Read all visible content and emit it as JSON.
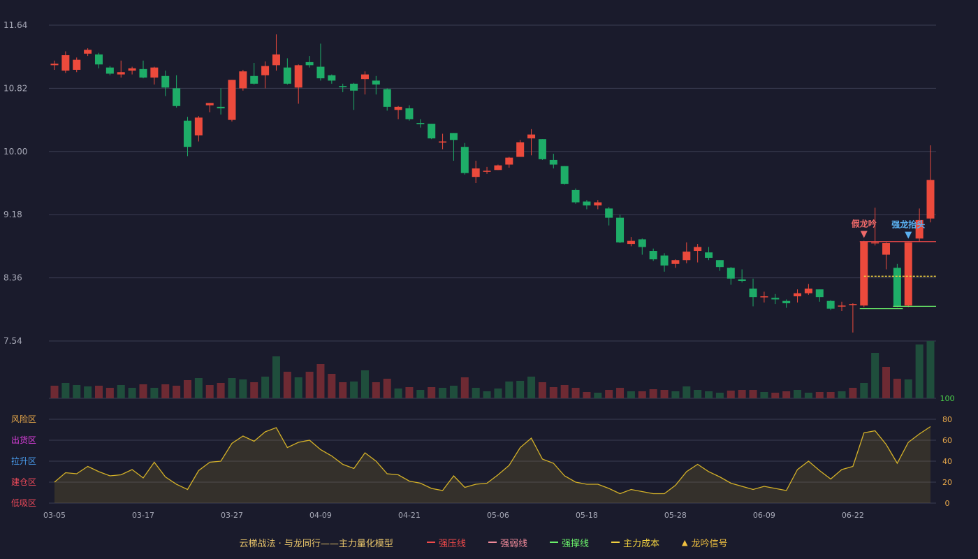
{
  "chart_data": {
    "type": "candlestick",
    "price_axis": {
      "ticks": [
        "11.64",
        "10.82",
        "10.00",
        "9.18",
        "8.36",
        "7.54"
      ],
      "min": 7.54,
      "max": 11.64
    },
    "oscillator_axis": {
      "ticks": [
        "100",
        "80",
        "60",
        "40",
        "20",
        "0"
      ],
      "min": 0,
      "max": 100
    },
    "zones": [
      {
        "label": "风险区",
        "value": 80,
        "color": "#e8a84a"
      },
      {
        "label": "出货区",
        "value": 60,
        "color": "#e040e0"
      },
      {
        "label": "拉升区",
        "value": 40,
        "color": "#4a9ef0"
      },
      {
        "label": "建仓区",
        "value": 20,
        "color": "#f04a5a"
      },
      {
        "label": "低吸区",
        "value": 0,
        "color": "#f04a5a"
      }
    ],
    "x_labels": [
      {
        "i": 0,
        "label": "03-05"
      },
      {
        "i": 8,
        "label": "03-17"
      },
      {
        "i": 16,
        "label": "03-27"
      },
      {
        "i": 24,
        "label": "04-09"
      },
      {
        "i": 32,
        "label": "04-21"
      },
      {
        "i": 40,
        "label": "05-06"
      },
      {
        "i": 48,
        "label": "05-18"
      },
      {
        "i": 56,
        "label": "05-28"
      },
      {
        "i": 64,
        "label": "06-09"
      },
      {
        "i": 72,
        "label": "06-22"
      }
    ],
    "candles": [
      [
        11.12,
        11.14,
        11.06,
        11.18
      ],
      [
        11.05,
        11.25,
        11.02,
        11.3
      ],
      [
        11.06,
        11.19,
        11.03,
        11.22
      ],
      [
        11.27,
        11.32,
        11.24,
        11.34
      ],
      [
        11.26,
        11.13,
        11.08,
        11.28
      ],
      [
        11.09,
        11.01,
        10.99,
        11.11
      ],
      [
        11.0,
        11.03,
        10.96,
        11.18
      ],
      [
        11.05,
        11.08,
        11.0,
        11.1
      ],
      [
        11.07,
        10.96,
        10.95,
        11.18
      ],
      [
        10.96,
        11.09,
        10.87,
        11.1
      ],
      [
        10.98,
        10.83,
        10.72,
        11.05
      ],
      [
        10.82,
        10.59,
        10.57,
        10.99
      ],
      [
        10.4,
        10.06,
        9.94,
        10.45
      ],
      [
        10.21,
        10.44,
        10.13,
        10.46
      ],
      [
        10.6,
        10.63,
        10.51,
        10.63
      ],
      [
        10.58,
        10.56,
        10.48,
        10.82
      ],
      [
        10.41,
        10.93,
        10.39,
        10.93
      ],
      [
        10.82,
        11.04,
        10.79,
        11.06
      ],
      [
        10.98,
        10.88,
        10.87,
        11.15
      ],
      [
        10.99,
        11.11,
        10.82,
        11.17
      ],
      [
        11.12,
        11.26,
        11.05,
        11.52
      ],
      [
        11.09,
        10.88,
        10.87,
        11.21
      ],
      [
        10.83,
        11.12,
        10.62,
        11.13
      ],
      [
        11.16,
        11.12,
        11.09,
        11.24
      ],
      [
        11.1,
        10.95,
        10.92,
        11.4
      ],
      [
        10.99,
        10.92,
        10.88,
        11.0
      ],
      [
        10.85,
        10.84,
        10.77,
        10.88
      ],
      [
        10.88,
        10.79,
        10.54,
        10.89
      ],
      [
        10.94,
        11.0,
        10.74,
        11.04
      ],
      [
        10.92,
        10.87,
        10.74,
        10.98
      ],
      [
        10.81,
        10.58,
        10.53,
        10.82
      ],
      [
        10.54,
        10.58,
        10.42,
        10.59
      ],
      [
        10.56,
        10.42,
        10.4,
        10.6
      ],
      [
        10.37,
        10.36,
        10.31,
        10.42
      ],
      [
        10.36,
        10.17,
        10.16,
        10.36
      ],
      [
        10.12,
        10.13,
        10.03,
        10.23
      ],
      [
        10.24,
        10.15,
        9.88,
        10.24
      ],
      [
        10.06,
        9.72,
        9.7,
        10.11
      ],
      [
        9.67,
        9.78,
        9.59,
        9.88
      ],
      [
        9.74,
        9.75,
        9.71,
        9.8
      ],
      [
        9.76,
        9.82,
        9.76,
        9.83
      ],
      [
        9.83,
        9.92,
        9.79,
        9.93
      ],
      [
        9.93,
        10.12,
        9.93,
        10.15
      ],
      [
        10.17,
        10.22,
        9.95,
        10.29
      ],
      [
        10.16,
        9.9,
        9.89,
        10.16
      ],
      [
        9.89,
        9.83,
        9.78,
        9.97
      ],
      [
        9.81,
        9.58,
        9.57,
        9.81
      ],
      [
        9.5,
        9.34,
        9.32,
        9.52
      ],
      [
        9.35,
        9.3,
        9.25,
        9.37
      ],
      [
        9.3,
        9.34,
        9.25,
        9.37
      ],
      [
        9.26,
        9.14,
        9.04,
        9.28
      ],
      [
        9.14,
        8.82,
        8.81,
        9.18
      ],
      [
        8.8,
        8.84,
        8.77,
        8.89
      ],
      [
        8.86,
        8.76,
        8.66,
        8.87
      ],
      [
        8.71,
        8.6,
        8.58,
        8.74
      ],
      [
        8.65,
        8.52,
        8.44,
        8.68
      ],
      [
        8.54,
        8.59,
        8.49,
        8.6
      ],
      [
        8.59,
        8.7,
        8.55,
        8.82
      ],
      [
        8.71,
        8.76,
        8.56,
        8.8
      ],
      [
        8.69,
        8.62,
        8.59,
        8.76
      ],
      [
        8.59,
        8.5,
        8.45,
        8.59
      ],
      [
        8.49,
        8.35,
        8.27,
        8.5
      ],
      [
        8.34,
        8.32,
        8.3,
        8.47
      ],
      [
        8.22,
        8.11,
        7.99,
        8.35
      ],
      [
        8.11,
        8.12,
        8.04,
        8.18
      ],
      [
        8.1,
        8.08,
        8.02,
        8.15
      ],
      [
        8.06,
        8.03,
        7.97,
        8.08
      ],
      [
        8.12,
        8.16,
        8.04,
        8.21
      ],
      [
        8.16,
        8.22,
        8.14,
        8.28
      ],
      [
        8.21,
        8.11,
        8.05,
        8.21
      ],
      [
        8.06,
        7.96,
        7.94,
        8.07
      ],
      [
        8.0,
        8.0,
        7.93,
        8.05
      ],
      [
        8.01,
        8.02,
        7.65,
        8.03
      ],
      [
        8.0,
        8.83,
        7.98,
        8.84
      ],
      [
        8.82,
        8.82,
        8.78,
        9.27
      ],
      [
        8.66,
        8.81,
        8.47,
        8.82
      ],
      [
        8.49,
        7.99,
        7.98,
        8.54
      ],
      [
        8.0,
        8.82,
        7.98,
        8.82
      ],
      [
        8.87,
        9.11,
        8.83,
        9.26
      ],
      [
        9.13,
        9.63,
        9.08,
        10.08
      ]
    ],
    "volume": [
      [
        18,
        "up"
      ],
      [
        22,
        "down"
      ],
      [
        19,
        "down"
      ],
      [
        17,
        "down"
      ],
      [
        18,
        "up"
      ],
      [
        15,
        "up"
      ],
      [
        19,
        "down"
      ],
      [
        15,
        "down"
      ],
      [
        20,
        "up"
      ],
      [
        15,
        "down"
      ],
      [
        20,
        "up"
      ],
      [
        18,
        "up"
      ],
      [
        26,
        "up"
      ],
      [
        29,
        "down"
      ],
      [
        19,
        "up"
      ],
      [
        22,
        "up"
      ],
      [
        29,
        "down"
      ],
      [
        27,
        "down"
      ],
      [
        23,
        "up"
      ],
      [
        31,
        "down"
      ],
      [
        60,
        "down"
      ],
      [
        38,
        "up"
      ],
      [
        30,
        "down"
      ],
      [
        38,
        "up"
      ],
      [
        49,
        "up"
      ],
      [
        35,
        "up"
      ],
      [
        23,
        "up"
      ],
      [
        24,
        "down"
      ],
      [
        40,
        "down"
      ],
      [
        23,
        "up"
      ],
      [
        28,
        "up"
      ],
      [
        14,
        "down"
      ],
      [
        16,
        "up"
      ],
      [
        12,
        "down"
      ],
      [
        16,
        "up"
      ],
      [
        15,
        "down"
      ],
      [
        18,
        "down"
      ],
      [
        30,
        "up"
      ],
      [
        15,
        "down"
      ],
      [
        10,
        "down"
      ],
      [
        14,
        "down"
      ],
      [
        24,
        "down"
      ],
      [
        25,
        "down"
      ],
      [
        31,
        "down"
      ],
      [
        23,
        "up"
      ],
      [
        16,
        "up"
      ],
      [
        19,
        "up"
      ],
      [
        15,
        "up"
      ],
      [
        9,
        "up"
      ],
      [
        8,
        "down"
      ],
      [
        12,
        "up"
      ],
      [
        15,
        "up"
      ],
      [
        10,
        "down"
      ],
      [
        10,
        "up"
      ],
      [
        13,
        "up"
      ],
      [
        12,
        "up"
      ],
      [
        10,
        "down"
      ],
      [
        17,
        "down"
      ],
      [
        12,
        "down"
      ],
      [
        10,
        "down"
      ],
      [
        8,
        "down"
      ],
      [
        11,
        "up"
      ],
      [
        12,
        "up"
      ],
      [
        12,
        "up"
      ],
      [
        9,
        "down"
      ],
      [
        8,
        "up"
      ],
      [
        10,
        "up"
      ],
      [
        12,
        "down"
      ],
      [
        8,
        "down"
      ],
      [
        9,
        "up"
      ],
      [
        9,
        "up"
      ],
      [
        10,
        "down"
      ],
      [
        15,
        "up"
      ],
      [
        22,
        "down"
      ],
      [
        65,
        "down"
      ],
      [
        45,
        "up"
      ],
      [
        28,
        "up"
      ],
      [
        27,
        "down"
      ],
      [
        77,
        "down"
      ],
      [
        82,
        "down"
      ]
    ],
    "volume_max": 82,
    "oscillator": [
      20,
      29,
      28,
      35,
      30,
      26,
      27,
      32,
      24,
      39,
      25,
      18,
      13,
      31,
      39,
      40,
      57,
      64,
      59,
      68,
      72,
      53,
      58,
      60,
      51,
      45,
      37,
      33,
      48,
      40,
      28,
      27,
      21,
      19,
      14,
      12,
      26,
      15,
      18,
      19,
      27,
      36,
      53,
      62,
      42,
      38,
      26,
      20,
      18,
      18,
      14,
      9,
      13,
      11,
      9,
      9,
      17,
      30,
      37,
      30,
      25,
      19,
      16,
      13,
      16,
      14,
      12,
      32,
      40,
      31,
      23,
      32,
      35,
      67,
      69,
      56,
      38,
      58,
      66,
      73
    ],
    "strong_pressure_line": {
      "value": 8.83,
      "from": 73,
      "to": 79,
      "label": "强压线",
      "color": "#f04a4a"
    },
    "strong_support_line": [
      {
        "value": 7.96,
        "from": 73,
        "to": 76
      },
      {
        "value": 7.99,
        "from": 76,
        "to": 79
      }
    ],
    "main_cost_line": {
      "value": 8.38,
      "from": 73,
      "to": 79
    },
    "signals": [
      {
        "i": 73,
        "label": "假龙吟",
        "color": "#f06a6a",
        "price": 8.86
      },
      {
        "i": 77,
        "label": "强龙抬头",
        "color": "#5ab0f0",
        "price": 8.85
      }
    ],
    "colors": {
      "up": "#ec4a3c",
      "down": "#1ead68",
      "vol_up": "#6e2a33",
      "vol_down": "#1f4e3c",
      "osc": "#d4b128"
    }
  },
  "legend": {
    "title": "云梯战法 · 与龙同行——主力量化模型",
    "items": [
      {
        "label": "强压线",
        "color": "#f04a4a",
        "style": "solid"
      },
      {
        "label": "强弱线",
        "color": "#f08a9a",
        "style": "dashed"
      },
      {
        "label": "强撑线",
        "color": "#6af06a",
        "style": "solid"
      },
      {
        "label": "主力成本",
        "color": "#f0d040",
        "style": "dashed"
      },
      {
        "label": "龙吟信号",
        "color": "#f0c040",
        "style": "triangle"
      }
    ]
  }
}
